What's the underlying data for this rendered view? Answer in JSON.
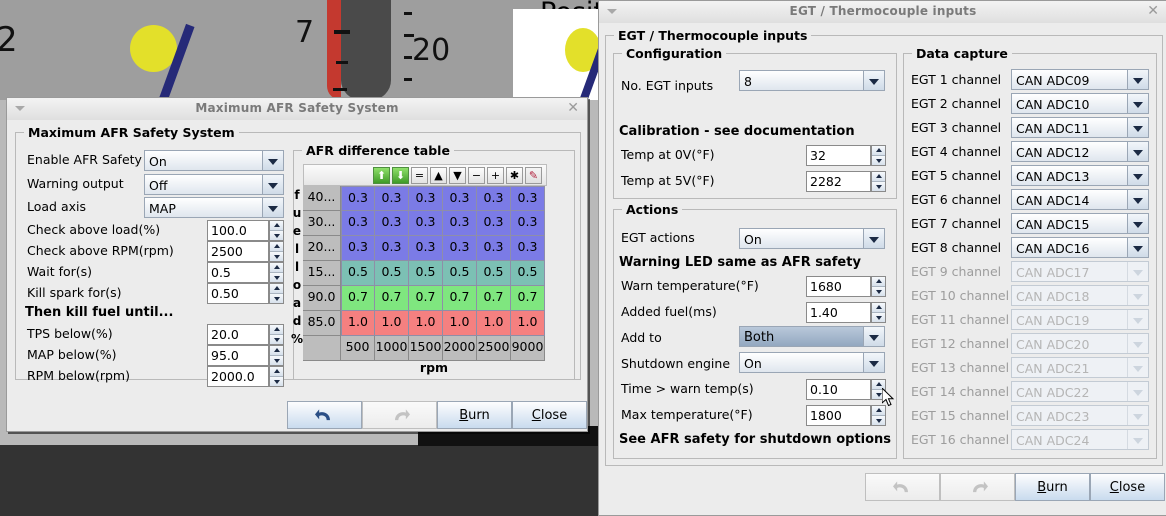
{
  "background": {
    "numbers": [
      "2",
      "7",
      "20"
    ],
    "gauge_label": "Posit"
  },
  "afr_window": {
    "title": "Maximum AFR Safety System",
    "menu_icon": "window-menu-icon",
    "close_icon": "close-icon",
    "group_label": "Maximum AFR Safety System",
    "fields": [
      {
        "label": "Enable AFR Safety",
        "value": "On",
        "type": "combo"
      },
      {
        "label": "Warning output",
        "value": "Off",
        "type": "combo"
      },
      {
        "label": "Load axis",
        "value": "MAP",
        "type": "combo"
      },
      {
        "label": "Check above load(%)",
        "value": "100.0",
        "type": "spin"
      },
      {
        "label": "Check above RPM(rpm)",
        "value": "2500",
        "type": "spin"
      },
      {
        "label": "Wait for(s)",
        "value": "0.5",
        "type": "spin"
      },
      {
        "label": "Kill spark for(s)",
        "value": "0.50",
        "type": "spin"
      }
    ],
    "section_heading": "Then kill fuel until...",
    "fields2": [
      {
        "label": "TPS below(%)",
        "value": "20.0",
        "type": "spin"
      },
      {
        "label": "MAP below(%)",
        "value": "95.0",
        "type": "spin"
      },
      {
        "label": "RPM below(rpm)",
        "value": "2000.0",
        "type": "spin"
      }
    ],
    "table": {
      "group_label": "AFR difference table",
      "y_axis_label": "fuel load %",
      "x_axis_label": "rpm",
      "toolbar_buttons": [
        {
          "name": "scale-up-icon",
          "glyph": "⬆",
          "style": "g"
        },
        {
          "name": "scale-down-icon",
          "glyph": "⬇",
          "style": "g"
        },
        {
          "name": "equal-icon",
          "glyph": "=",
          "style": ""
        },
        {
          "name": "increase-icon",
          "glyph": "▲",
          "style": ""
        },
        {
          "name": "decrease-icon",
          "glyph": "▼",
          "style": ""
        },
        {
          "name": "minus-icon",
          "glyph": "−",
          "style": ""
        },
        {
          "name": "plus-icon",
          "glyph": "+",
          "style": ""
        },
        {
          "name": "multiply-icon",
          "glyph": "✱",
          "style": ""
        },
        {
          "name": "pencil-icon",
          "glyph": "✎",
          "style": "pen"
        }
      ],
      "row_headers": [
        "40...",
        "30...",
        "20...",
        "15...",
        "90.0",
        "85.0"
      ],
      "col_headers": [
        "500",
        "1000",
        "1500",
        "2000",
        "2500",
        "9000"
      ],
      "rows": [
        {
          "values": [
            "0.3",
            "0.3",
            "0.3",
            "0.3",
            "0.3",
            "0.3"
          ],
          "color": "#7b7be6"
        },
        {
          "values": [
            "0.3",
            "0.3",
            "0.3",
            "0.3",
            "0.3",
            "0.3"
          ],
          "color": "#7b7be6"
        },
        {
          "values": [
            "0.3",
            "0.3",
            "0.3",
            "0.3",
            "0.3",
            "0.3"
          ],
          "color": "#7b7be6"
        },
        {
          "values": [
            "0.5",
            "0.5",
            "0.5",
            "0.5",
            "0.5",
            "0.5"
          ],
          "color": "#7cc0b4"
        },
        {
          "values": [
            "0.7",
            "0.7",
            "0.7",
            "0.7",
            "0.7",
            "0.7"
          ],
          "color": "#7fe67f"
        },
        {
          "values": [
            "1.0",
            "1.0",
            "1.0",
            "1.0",
            "1.0",
            "1.0"
          ],
          "color": "#f58080"
        }
      ]
    },
    "buttons": [
      {
        "name": "undo-button",
        "label": "",
        "icon": "undo-icon",
        "enabled": true
      },
      {
        "name": "redo-button",
        "label": "",
        "icon": "redo-icon",
        "enabled": false
      },
      {
        "name": "burn-button",
        "label": "Burn",
        "mnemonic": "B",
        "enabled": true
      },
      {
        "name": "close-button",
        "label": "Close",
        "mnemonic": "C",
        "enabled": true
      }
    ]
  },
  "egt_window": {
    "title": "EGT / Thermocouple inputs",
    "menu_icon": "window-menu-icon",
    "close_icon": "close-icon",
    "group_label": "EGT / Thermocouple inputs",
    "configuration": {
      "label": "Configuration",
      "no_inputs_label": "No. EGT inputs",
      "no_inputs_value": "8",
      "calibration_heading": "Calibration - see documentation",
      "fields": [
        {
          "label": "Temp at 0V(°F)",
          "value": "32"
        },
        {
          "label": "Temp at 5V(°F)",
          "value": "2282"
        }
      ]
    },
    "actions": {
      "label": "Actions",
      "egt_actions_label": "EGT actions",
      "egt_actions_value": "On",
      "warning_heading": "Warning LED same as AFR safety",
      "warn_temp_label": "Warn temperature(°F)",
      "warn_temp_value": "1680",
      "added_fuel_label": "Added fuel(ms)",
      "added_fuel_value": "1.40",
      "add_to_label": "Add to",
      "add_to_value": "Both",
      "shutdown_label": "Shutdown engine",
      "shutdown_value": "On",
      "time_warn_label": "Time > warn temp(s)",
      "time_warn_value": "0.10",
      "max_temp_label": "Max temperature(°F)",
      "max_temp_value": "1800",
      "footer_note": "See AFR safety for shutdown options"
    },
    "data_capture": {
      "label": "Data capture",
      "channels": [
        {
          "label": "EGT 1 channel",
          "value": "CAN ADC09",
          "enabled": true
        },
        {
          "label": "EGT 2 channel",
          "value": "CAN ADC10",
          "enabled": true
        },
        {
          "label": "EGT 3 channel",
          "value": "CAN ADC11",
          "enabled": true
        },
        {
          "label": "EGT 4 channel",
          "value": "CAN ADC12",
          "enabled": true
        },
        {
          "label": "EGT 5 channel",
          "value": "CAN ADC13",
          "enabled": true
        },
        {
          "label": "EGT 6 channel",
          "value": "CAN ADC14",
          "enabled": true
        },
        {
          "label": "EGT 7 channel",
          "value": "CAN ADC15",
          "enabled": true
        },
        {
          "label": "EGT 8 channel",
          "value": "CAN ADC16",
          "enabled": true
        },
        {
          "label": "EGT 9 channel",
          "value": "CAN ADC17",
          "enabled": false
        },
        {
          "label": "EGT 10 channel",
          "value": "CAN ADC18",
          "enabled": false
        },
        {
          "label": "EGT 11 channel",
          "value": "CAN ADC19",
          "enabled": false
        },
        {
          "label": "EGT 12 channel",
          "value": "CAN ADC20",
          "enabled": false
        },
        {
          "label": "EGT 13 channel",
          "value": "CAN ADC21",
          "enabled": false
        },
        {
          "label": "EGT 14 channel",
          "value": "CAN ADC22",
          "enabled": false
        },
        {
          "label": "EGT 15 channel",
          "value": "CAN ADC23",
          "enabled": false
        },
        {
          "label": "EGT 16 channel",
          "value": "CAN ADC24",
          "enabled": false
        }
      ]
    },
    "buttons": [
      {
        "name": "undo-button",
        "label": "",
        "icon": "undo-icon",
        "enabled": false
      },
      {
        "name": "redo-button",
        "label": "",
        "icon": "redo-icon",
        "enabled": false
      },
      {
        "name": "burn-button",
        "label": "Burn",
        "mnemonic": "B",
        "enabled": true
      },
      {
        "name": "close-button",
        "label": "Close",
        "mnemonic": "C",
        "enabled": true
      }
    ]
  }
}
